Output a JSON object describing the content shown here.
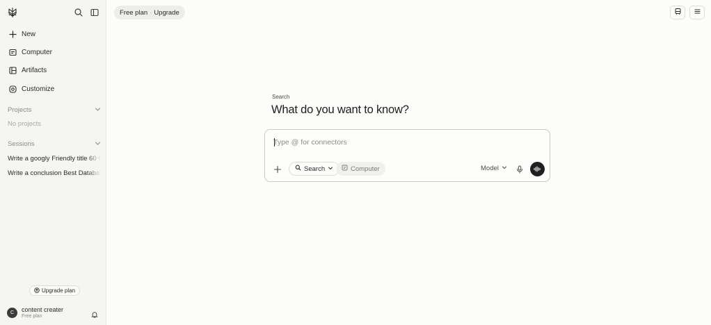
{
  "sidebar": {
    "nav": [
      {
        "label": "New",
        "icon": "plus-icon"
      },
      {
        "label": "Computer",
        "icon": "computer-icon"
      },
      {
        "label": "Artifacts",
        "icon": "artifacts-icon"
      },
      {
        "label": "Customize",
        "icon": "customize-icon"
      }
    ],
    "projects": {
      "title": "Projects",
      "empty": "No projects"
    },
    "sessions": {
      "title": "Sessions",
      "items": [
        "Write a googly Friendly title 60 C",
        "Write a conclusion Best Databa"
      ]
    },
    "upgrade_label": "Upgrade plan",
    "user": {
      "initial": "C",
      "name": "content creater",
      "plan": "Free plan"
    }
  },
  "header": {
    "plan": "Free plan",
    "separator": "·",
    "upgrade": "Upgrade"
  },
  "main": {
    "eyebrow": "Search",
    "headline": "What do you want to know?",
    "composer": {
      "placeholder": "Type @ for connectors",
      "search_chip": "Search",
      "computer_chip": "Computer",
      "model_label": "Model"
    }
  },
  "colors": {
    "background": "#fcfcfa",
    "sidebar": "#f5f5f2",
    "voice_button": "#1f1f1f"
  }
}
